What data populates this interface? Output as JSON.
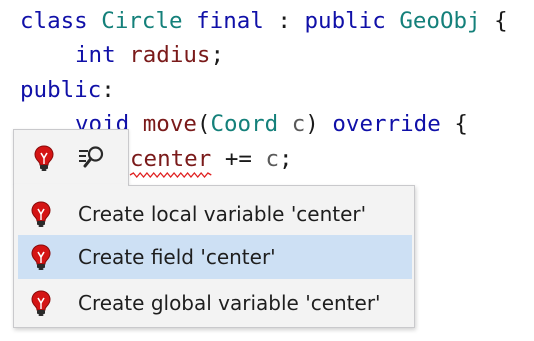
{
  "colors": {
    "keyword": "#1010a8",
    "type": "#14807a",
    "identifier": "#7a1a1a",
    "error_squiggle": "#e02020",
    "menu_background": "#f3f3f3",
    "menu_selection": "#cde0f4",
    "bulb_red": "#d41414"
  },
  "code": {
    "line1": {
      "kw_class": "class",
      "type_name": "Circle",
      "kw_final": "final",
      "colon": ":",
      "kw_public": "public",
      "base_type": "GeoObj",
      "brace": "{"
    },
    "line2": {
      "kw_int": "int",
      "field": "radius",
      "semi": ";"
    },
    "line3": {
      "kw_public": "public",
      "colon": ":"
    },
    "line4": {
      "kw_void": "void",
      "method": "move",
      "open_paren": "(",
      "param_type": "Coord",
      "param": "c",
      "close_paren": ")",
      "kw_override": "override",
      "brace": "{"
    },
    "line5": {
      "unresolved": "center",
      "op": "+=",
      "arg": "c",
      "semi": ";"
    }
  },
  "quick_actions": {
    "strip_icons": [
      "lightbulb-error-icon",
      "search-usages-icon"
    ],
    "menu_icon": "lightbulb-error-icon",
    "items": [
      {
        "label": "Create local variable 'center'",
        "selected": false
      },
      {
        "label": "Create field 'center'",
        "selected": true
      },
      {
        "label": "Create global variable 'center'",
        "selected": false
      }
    ]
  }
}
